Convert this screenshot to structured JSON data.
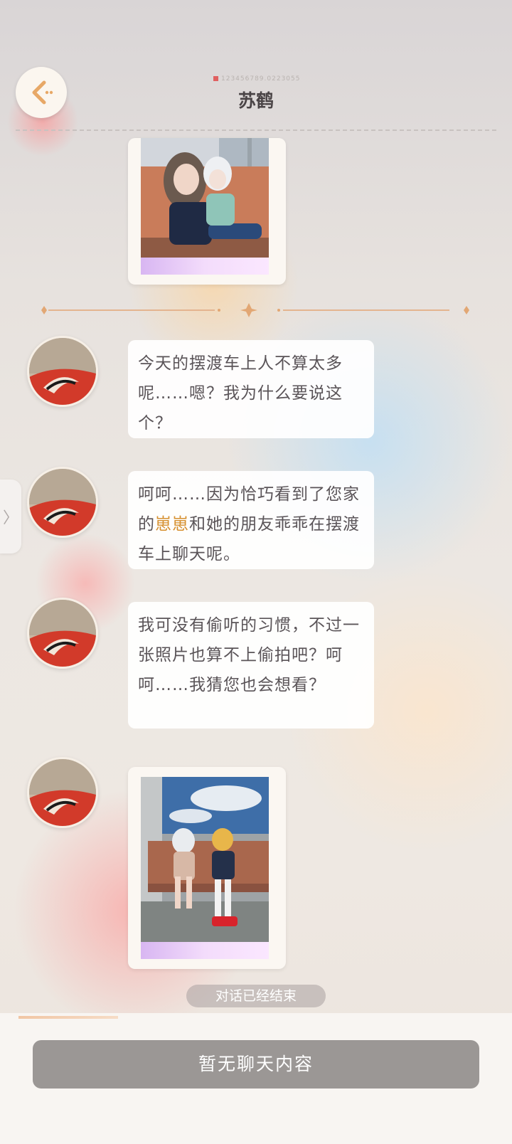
{
  "header": {
    "title": "苏鹤",
    "sub_code": "123456789.0223055"
  },
  "messages": [
    {
      "type": "image",
      "description_icon": "photo-subway-two-girls"
    },
    {
      "type": "text",
      "text_parts": [
        "今天的摆渡车上人不算太多呢……嗯？我为什么要说这个？"
      ]
    },
    {
      "type": "text",
      "text_before": "呵呵……因为恰巧看到了您家的",
      "highlight": "崽崽",
      "text_after": "和她的朋友乖乖在摆渡车上聊天呢。"
    },
    {
      "type": "text",
      "text_parts": [
        "我可没有偷听的习惯，不过一张照片也算不上偷拍吧？呵呵……我猜您也会想看？"
      ]
    },
    {
      "type": "image",
      "description_icon": "photo-bus-two-girls"
    }
  ],
  "status": {
    "conversation_ended": "对话已经结束"
  },
  "footer": {
    "no_content_label": "暂无聊天内容"
  },
  "side_tab": {
    "icon": "chevron-right-icon",
    "glyph": "〉"
  },
  "colors": {
    "highlight": "#d6902f",
    "footer_button": "#9b9795",
    "accent": "#f1c6a4"
  }
}
